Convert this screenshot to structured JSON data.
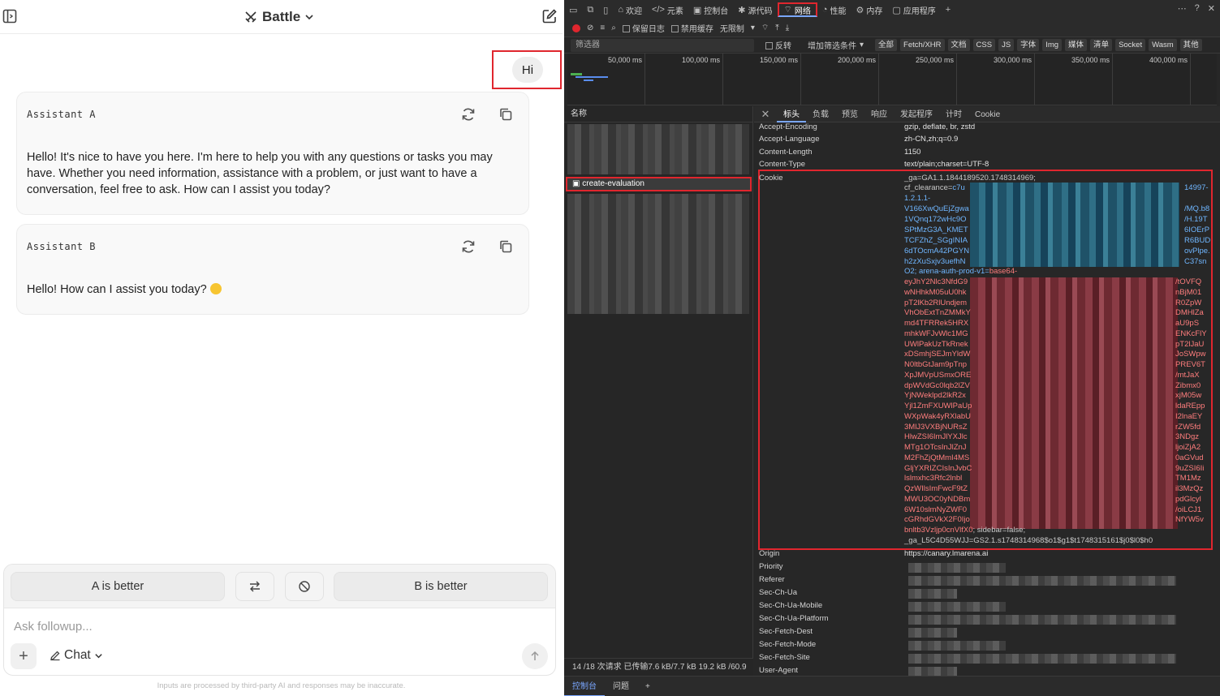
{
  "chat": {
    "header_title": "Battle",
    "user_message": "Hi",
    "assistant_a": {
      "name": "Assistant A",
      "text": "Hello! It's nice to have you here. I'm here to help you with any questions or tasks you may have. Whether you need information, assistance with a problem, or just want to have a conversation, feel free to ask. How can I assist you today?"
    },
    "assistant_b": {
      "name": "Assistant B",
      "text": "Hello! How can I assist you today?"
    },
    "vote": {
      "a_label": "A is better",
      "b_label": "B is better"
    },
    "followup_placeholder": "Ask followup...",
    "mode_label": "Chat",
    "disclaimer": "Inputs are processed by third-party AI and responses may be inaccurate."
  },
  "devtools": {
    "tabs": [
      "欢迎",
      "元素",
      "控制台",
      "源代码",
      "网络",
      "性能",
      "内存",
      "应用程序"
    ],
    "active_tab": "网络",
    "toolbar": {
      "preserve_log": "保留日志",
      "disable_cache": "禁用缓存",
      "throttle": "无限制"
    },
    "filter": {
      "placeholder": "筛选器",
      "invert": "反转",
      "more_filters": "增加筛选条件",
      "types": [
        "全部",
        "Fetch/XHR",
        "文档",
        "CSS",
        "JS",
        "字体",
        "Img",
        "媒体",
        "清单",
        "Socket",
        "Wasm",
        "其他"
      ]
    },
    "timeline_ticks": [
      "50,000 ms",
      "100,000 ms",
      "150,000 ms",
      "200,000 ms",
      "250,000 ms",
      "300,000 ms",
      "350,000 ms",
      "400,000 ms"
    ],
    "request_list": {
      "header": "名称",
      "selected": "create-evaluation",
      "footer": "14 /18 次请求   已传输7.6 kB/7.7 kB   19.2 kB /60.9"
    },
    "detail_tabs": [
      "标头",
      "负载",
      "预览",
      "响应",
      "发起程序",
      "计时",
      "Cookie"
    ],
    "headers": {
      "accept_encoding": {
        "k": "Accept-Encoding",
        "v": "gzip, deflate, br, zstd"
      },
      "accept_language": {
        "k": "Accept-Language",
        "v": "zh-CN,zh;q=0.9"
      },
      "content_length": {
        "k": "Content-Length",
        "v": "1150"
      },
      "content_type": {
        "k": "Content-Type",
        "v": "text/plain;charset=UTF-8"
      },
      "cookie_key": "Cookie",
      "cookie_line1": "_ga=GA1.1.1844189520.1748314969;",
      "cookie_cf_name": "cf_clearance=",
      "cookie_cf_val": "c7u",
      "cookie_cf_end": "14997-",
      "cookie_blue_left": [
        "1.2.1.1-",
        "V166XwQuEjZgwa",
        "1VQnq172wHc9O",
        "SPtMzG3A_KMET",
        "TCFZhZ_SGgINIA",
        "6dTOcmA42PGYN",
        "h2zXuSxjv3uefhN"
      ],
      "cookie_blue_right": [
        "",
        "/MQ.b8",
        "/H.19T",
        "6IOErP",
        "R6BUD",
        "ovPlpe.",
        "C37sn"
      ],
      "cookie_arena_prefix": "O2; arena-auth-prod-v1=",
      "cookie_arena_val": "base64-",
      "cookie_red_left": [
        "eyJhY2Nlc3NfdG9",
        "wNHhkM05uU0hk",
        "pT2lKb2RlUndjem",
        "VhObExtTnZMMkY",
        "md4TFRRek5HRX",
        "mhkWFJvWlc1MG",
        "UWlPakUzTkRnek",
        "xDSmhjSEJmYldW",
        "N0ltbGtJam9pTnp",
        "XpJMVpUSmxORE",
        "dpWVdGc0lqb2lZV",
        "YjNWeklpd2lkR2x",
        "Yjl1ZmFXUWlPaUp",
        "WXpWak4yRXlabU",
        "3MlJ3VXBjNURsZ",
        "HlwZSI6ImJlYXJlc",
        "MTg1OTcsInJlZnJ",
        "M2FhZjQtMmI4MS",
        "GljYXRIZCIsInJvbC",
        "lslmxhc3Rfc2lnbl",
        "QzWIlsImFwcF9tZ",
        "MWU3OC0yNDBm",
        "6W10slmNyZWF0",
        "cGRhdGVkX2F0Ijo"
      ],
      "cookie_red_right": [
        "/tOVFQ",
        "nBjM01",
        "R0ZpW",
        "DMHlZa",
        "aU9pS",
        "ENKcFlY",
        "pT2lJaU",
        "JoSWpw",
        "PREV6T",
        "/mtJaX",
        "Zibmx0",
        "xjM05w",
        "ldaREpp",
        "I2lnaEY",
        "rZW5fd",
        "3NDgz",
        "ljoiZjA2",
        "0aGVud",
        "9uZSI6Ii",
        "TM1Mz",
        "il3MzQz",
        "pdGlcyl",
        "/oiLCJ1",
        "NfYW5v"
      ],
      "cookie_tail1a": "bnltb3Vzljp0cnVlfX0",
      "cookie_tail1b": "; sidebar=false;",
      "cookie_tail2": "_ga_L5C4D55WJJ=GS2.1.s1748314968$o1$g1$t1748315161$j0$l0$h0",
      "origin": {
        "k": "Origin",
        "v": "https://canary.lmarena.ai"
      },
      "blurred_keys": [
        "Priority",
        "Referer",
        "Sec-Ch-Ua",
        "Sec-Ch-Ua-Mobile",
        "Sec-Ch-Ua-Platform",
        "Sec-Fetch-Dest",
        "Sec-Fetch-Mode",
        "Sec-Fetch-Site",
        "User-Agent"
      ]
    },
    "drawer": {
      "console": "控制台",
      "issues": "问题"
    }
  }
}
